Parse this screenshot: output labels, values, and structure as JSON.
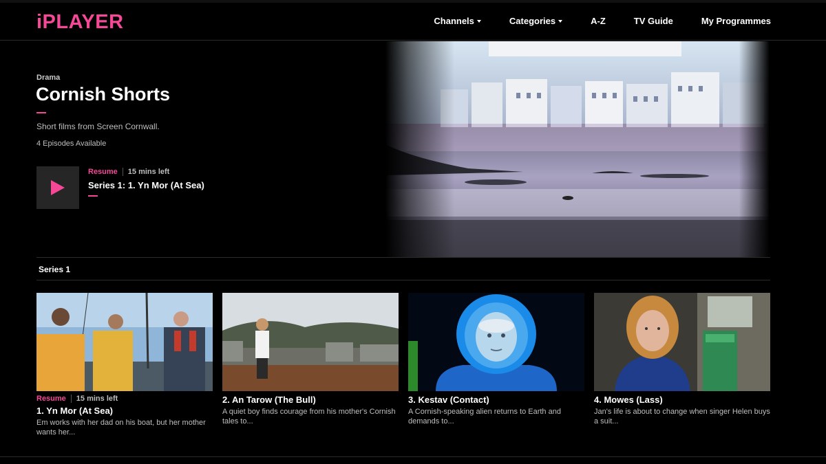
{
  "header": {
    "logo": "iPLAYER",
    "nav": [
      {
        "label": "Channels",
        "dropdown": true
      },
      {
        "label": "Categories",
        "dropdown": true
      },
      {
        "label": "A-Z",
        "dropdown": false
      },
      {
        "label": "TV Guide",
        "dropdown": false
      },
      {
        "label": "My Programmes",
        "dropdown": false
      }
    ]
  },
  "hero": {
    "genre": "Drama",
    "title": "Cornish Shorts",
    "synopsis": "Short films from Screen Cornwall.",
    "episode_count": "4 Episodes Available",
    "resume_label": "Resume",
    "time_left": "15 mins left",
    "resume_episode": "Series 1: 1. Yn Mor (At Sea)"
  },
  "series": {
    "label": "Series 1",
    "episodes": [
      {
        "title": "1. Yn Mor (At Sea)",
        "description": "Em works with her dad on his boat, but her mother wants her...",
        "resume_label": "Resume",
        "time_left": "15 mins left"
      },
      {
        "title": "2. An Tarow (The Bull)",
        "description": "A quiet boy finds courage from his mother's Cornish tales to..."
      },
      {
        "title": "3. Kestav (Contact)",
        "description": "A Cornish-speaking alien returns to Earth and demands to..."
      },
      {
        "title": "4. Mowes (Lass)",
        "description": "Jan's life is about to change when singer Helen buys a suit..."
      }
    ]
  },
  "colors": {
    "accent": "#f54997",
    "background": "#000000",
    "muted_text": "#bfbfbf"
  }
}
